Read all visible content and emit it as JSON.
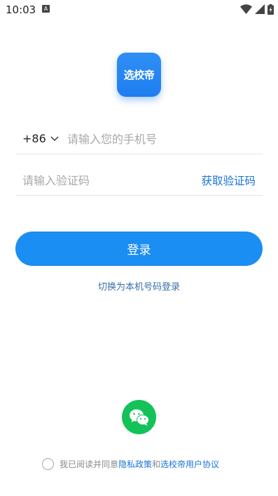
{
  "status_bar": {
    "time": "10:03",
    "notification_badge": "A"
  },
  "logo": {
    "text": "选校帝",
    "color": "#2185f2"
  },
  "phone": {
    "country_code": "+86",
    "placeholder": "请输入您的手机号"
  },
  "code": {
    "placeholder": "请输入验证码",
    "get_code_label": "获取验证码"
  },
  "login": {
    "label": "登录",
    "color": "#1a8ef2"
  },
  "switch_login": {
    "label": "切换为本机号码登录"
  },
  "wechat": {
    "icon": "wechat-icon",
    "color": "#14c25a"
  },
  "agreement": {
    "prefix": "我已阅读并同意",
    "privacy_link": "隐私政策",
    "conjunction": "和",
    "terms_link": "选校帝用户协议"
  }
}
